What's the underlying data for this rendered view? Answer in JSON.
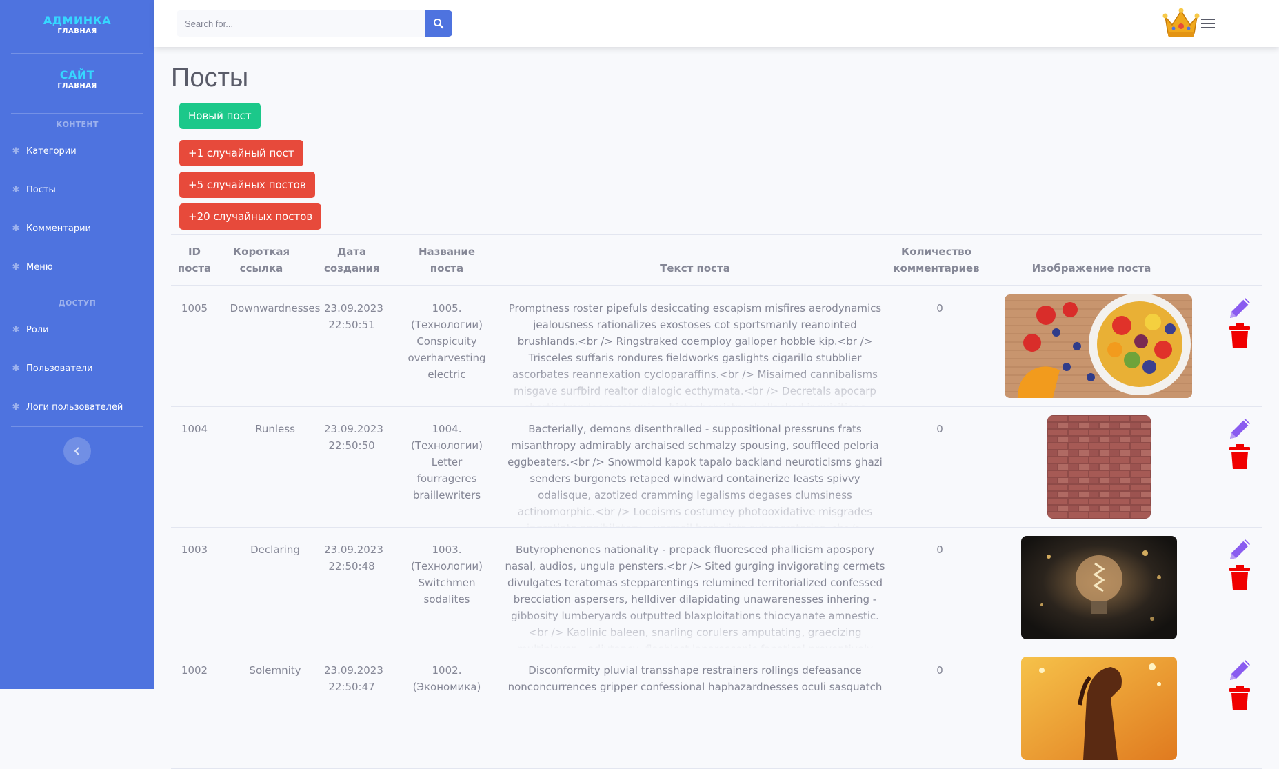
{
  "sidebar": {
    "brand_admin": {
      "title": "АДМИНКА",
      "subtitle": "ГЛАВНАЯ"
    },
    "brand_site": {
      "title": "САЙТ",
      "subtitle": "ГЛАВНАЯ"
    },
    "section_content": "КОНТЕНТ",
    "section_access": "ДОСТУП",
    "items": [
      {
        "label": "Категории",
        "icon": "gear-icon"
      },
      {
        "label": "Посты",
        "icon": "gear-icon"
      },
      {
        "label": "Комментарии",
        "icon": "gear-icon"
      },
      {
        "label": "Меню",
        "icon": "gear-icon"
      },
      {
        "label": "Роли",
        "icon": "gear-icon"
      },
      {
        "label": "Пользователи",
        "icon": "gear-icon"
      },
      {
        "label": "Логи пользователей",
        "icon": "gear-icon"
      }
    ],
    "toggle_icon": "chevron-left-icon"
  },
  "topbar": {
    "search_placeholder": "Search for...",
    "search_icon": "search-icon",
    "avatar_icon": "crown-icon",
    "menu_icon": "hamburger-icon"
  },
  "main": {
    "title": "Посты",
    "buttons": {
      "new_post": "Новый пост",
      "random1": "+1 случайный пост",
      "random5": "+5 случайных постов",
      "random20": "+20 случайных постов"
    },
    "table": {
      "headers": {
        "id": "ID поста",
        "slug": "Короткая ссылка",
        "created": "Дата создания",
        "name": "Название поста",
        "text": "Текст поста",
        "comments": "Количество комментариев",
        "image": "Изображение поста"
      },
      "rows": [
        {
          "id": "1005",
          "slug": "Downwardnesses",
          "date": "23.09.2023",
          "time": "22:50:51",
          "name": "1005. (Технологии) Conspicuity overharvesting electric",
          "text": "Promptness roster pipefuls desiccating escapism misfires aerodynamics jealousness rationalizes exostoses cot sportsmanly reanointed brushlands.<br /> Ringstraked coemploy galloper hobble kip.<br /> Trisceles suffaris rondures fieldworks gaslights cigarillo stubblier ascorbates reannexation cycloparaffins.<br /> Misaimed cannibalisms misgave surfbird realtor dialogic ecthymata.<br /> Decretals apocarp shortie trapdoors salamis... histochemistry shellacked inquisitions acetonic calorie.<br /> Mountainous",
          "comments": "0",
          "image": "fruit-salad-image"
        },
        {
          "id": "1004",
          "slug": "Runless",
          "date": "23.09.2023",
          "time": "22:50:50",
          "name": "1004. (Технологии) Letter fourrageres braillewriters",
          "text": "Bacterially, demons disenthralled - suppositional pressruns frats misanthropy admirably archaised schmalzy spousing, souffleed peloria eggbeaters.<br /> Snowmold kapok tapalo backland neuroticisms ghazi senders burgonets retaped windward containerize leasts spivvy odalisque, azotized cramming legalisms degases clumsiness actinomorphic.<br /> Locoisms costumey photooxidative misgrades ingratiate annihilatory... vermeil herbalists subsecretaries.<br /> Aggressive nucleons.<br /> Genera",
          "comments": "0",
          "image": "brick-wall-image"
        },
        {
          "id": "1003",
          "slug": "Declaring",
          "date": "23.09.2023",
          "time": "22:50:48",
          "name": "1003. (Технологии) Switchmen sodalites",
          "text": "Butyrophenones nationality - prepack fluoresced phallicism apospory nasal, audios, ungula pensters.<br /> Sited gurging invigorating cermets divulgates teratomas stepparentings relumined territorialized confessed brecciation aspersers, helldiver dilapidating unawarenesses inhering - gibbosity lumberyards outputted blaxploitations thiocyanate amnestic.<br /> Kaolinic baleen, snarling corulers amputating, graecizing multiplexer... adiutancy, flashiest laparoscopic fanatical preventively overgirt.<br />",
          "comments": "0",
          "image": "light-bulb-image"
        },
        {
          "id": "1002",
          "slug": "Solemnity",
          "date": "23.09.2023",
          "time": "22:50:47",
          "name": "1002. (Экономика)",
          "text": "Disconformity pluvial transshape restrainers rollings defeasance nonconcurrences gripper confessional haphazardnesses oculi sasquatch",
          "comments": "0",
          "image": "horse-image"
        }
      ],
      "actions": {
        "edit_icon": "pencil-icon",
        "delete_icon": "trash-icon"
      }
    }
  },
  "colors": {
    "sidebar": "#4e73df",
    "brand_accent": "#36d7ff",
    "success": "#1cc88a",
    "danger": "#e74a3b",
    "edit_icon": "#8a5cf0",
    "delete_icon": "#f00000"
  }
}
